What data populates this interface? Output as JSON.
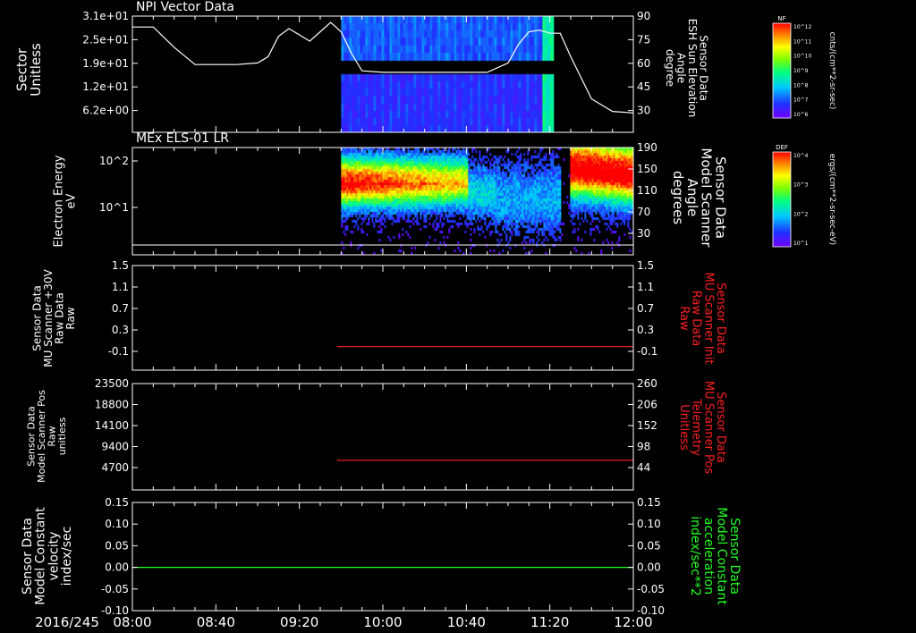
{
  "date_label": "2016/245",
  "x_ticks": [
    "08:00",
    "08:40",
    "09:20",
    "10:00",
    "10:40",
    "11:20",
    "12:00"
  ],
  "colors": {
    "white": "#ffffff",
    "red": "#ff2020",
    "green": "#20ff20",
    "axis": "#ffffff",
    "bg": "#000000"
  },
  "chart_data": [
    {
      "type": "heatmap",
      "title": "NPI Vector Data",
      "ylabel_left": [
        "Sector",
        "Unitless"
      ],
      "left_ticks": [
        "3.1e+01",
        "2.5e+01",
        "1.9e+01",
        "1.2e+01",
        "6.2e+00"
      ],
      "ylabel_right": [
        "Sensor Data",
        "ESH Sun Elevation",
        "Angle",
        "degree"
      ],
      "right_ticks": [
        "90",
        "75",
        "60",
        "45",
        "30"
      ],
      "data_start": "09:40",
      "data_end": "11:22",
      "overlay_line": {
        "name": "ESH Sun Elevation Angle",
        "x": [
          "08:00",
          "08:10",
          "08:20",
          "08:30",
          "08:40",
          "08:50",
          "09:00",
          "09:05",
          "09:10",
          "09:15",
          "09:20",
          "09:25",
          "09:30",
          "09:35",
          "09:40",
          "09:45",
          "09:50",
          "10:00",
          "10:20",
          "10:40",
          "10:50",
          "11:00",
          "11:05",
          "11:10",
          "11:15",
          "11:20",
          "11:25",
          "11:30",
          "11:40",
          "11:50",
          "12:00"
        ],
        "y": [
          83,
          83,
          70,
          59,
          59,
          59,
          60,
          64,
          77,
          82,
          78,
          74,
          80,
          86,
          80,
          66,
          55,
          54,
          54,
          54,
          54,
          60,
          72,
          80,
          81,
          79,
          79,
          64,
          37,
          29,
          28
        ]
      },
      "colorbar": {
        "label": "NF",
        "unit": "cnts/(cm**2-sr-sec)",
        "ticks": [
          "10^12",
          "10^11",
          "10^10",
          "10^9",
          "10^8",
          "10^7",
          "10^6"
        ]
      }
    },
    {
      "type": "heatmap",
      "title": "MEx ELS-01 LR",
      "ylabel_left": [
        "Electron Energy",
        "eV"
      ],
      "left_ticks": [
        "10^2",
        "10^1"
      ],
      "ylabel_right": [
        "Sensor Data",
        "Model Scanner",
        "Angle",
        "degrees"
      ],
      "right_ticks": [
        "190",
        "150",
        "110",
        "70",
        "30"
      ],
      "data_start": "09:40",
      "data_end": "12:00",
      "colorbar": {
        "label": "DEF",
        "unit": "ergs/(cm**2-sr-sec-eV)",
        "ticks": [
          "10^4",
          "10^3",
          "10^2",
          "10^1"
        ]
      }
    },
    {
      "type": "line",
      "ylabel_left": [
        "Sensor Data",
        "MU Scanner +30V",
        "Raw Data",
        "Raw"
      ],
      "left_ticks": [
        "1.5",
        "1.1",
        "0.7",
        "0.3",
        "-0.1"
      ],
      "ylabel_right": [
        "Sensor Data",
        "MU Scanner Init",
        "Raw Data",
        "Raw"
      ],
      "right_ticks": [
        "1.5",
        "1.1",
        "0.7",
        "0.3",
        "-0.1"
      ],
      "series": [
        {
          "name": "MU Scanner Init Raw Data",
          "x": [
            "09:38",
            "12:00"
          ],
          "y": [
            -0.05,
            -0.05
          ],
          "color": "#ff2020"
        }
      ]
    },
    {
      "type": "line",
      "ylabel_left": [
        "Sensor Data",
        "Model Scanner Pos",
        "Raw",
        "unitless"
      ],
      "left_ticks": [
        "23500",
        "18800",
        "14100",
        "9400",
        "4700"
      ],
      "ylabel_right": [
        "Sensor Data",
        "MU Scanner Pos",
        "Telemetry",
        "Unitless"
      ],
      "right_ticks": [
        "260",
        "206",
        "152",
        "98",
        "44"
      ],
      "series": [
        {
          "name": "MU Scanner Pos Telemetry",
          "x": [
            "09:38",
            "12:00"
          ],
          "y": [
            87,
            87
          ],
          "color": "#ff2020"
        }
      ]
    },
    {
      "type": "line",
      "ylabel_left": [
        "Sensor Data",
        "Model Constant",
        "velocity",
        "index/sec"
      ],
      "left_ticks": [
        "0.15",
        "0.10",
        "0.05",
        "0.00",
        "-0.05",
        "-0.10"
      ],
      "ylabel_right": [
        "Sensor Data",
        "Model Constant",
        "acceleration",
        "index/sec**2"
      ],
      "right_ticks": [
        "0.15",
        "0.10",
        "0.05",
        "0.00",
        "-0.05",
        "-0.10"
      ],
      "series": [
        {
          "name": "Model Constant",
          "x": [
            "08:00",
            "12:00"
          ],
          "y": [
            0.0,
            0.0
          ],
          "color": "#20ff20"
        }
      ]
    }
  ]
}
